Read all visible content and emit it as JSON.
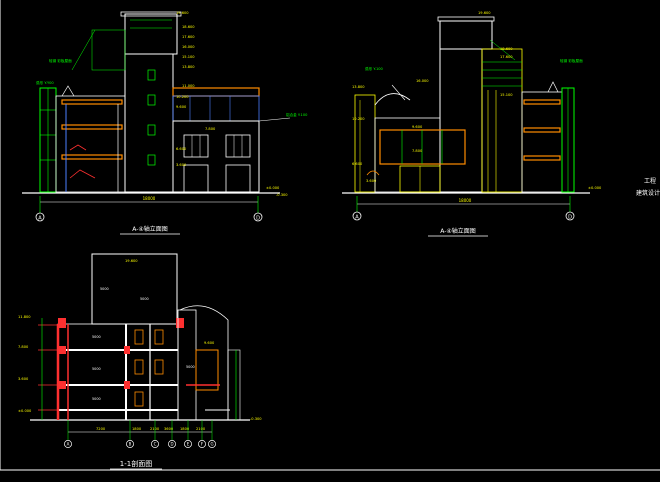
{
  "colors": {
    "background": "#000000",
    "frame": "#ffffff",
    "building": "#ffffff",
    "green": "#00ff00",
    "yellow": "#ffff00",
    "red": "#ff3030",
    "orange": "#ff8c00",
    "blue": "#4d7fff",
    "cyan": "#00ffff",
    "magenta": "#ff40ff",
    "pink": "#ff80c0",
    "dim": "#9a9a9a"
  },
  "drawing": {
    "front_elevation": {
      "title": "A-④轴立面图",
      "total_dim": "18000",
      "axis_left": "A",
      "axis_right": "D",
      "levels": [
        "19.600",
        "18.600",
        "17.600",
        "16.000",
        "15.100",
        "13.800",
        "11.000",
        "10.200",
        "9.600",
        "7.800",
        "6.600",
        "3.600",
        "±0.000",
        "-0.300"
      ],
      "notes": [
        "轻钢 彩板屋面",
        "铝合金 Y.100",
        "弧形 Y.Y00"
      ]
    },
    "side_elevation": {
      "title": "A-④轴立面图",
      "total_dim": "18000",
      "axis_left": "A",
      "axis_right": "D",
      "levels": [
        "19.600",
        "18.600",
        "17.600",
        "16.000",
        "15.100",
        "13.800",
        "10.200",
        "9.600",
        "7.800",
        "6.600",
        "3.600",
        "±0.000"
      ],
      "notes": [
        "弧形 Y.100",
        "轻钢 彩板屋面"
      ]
    },
    "section": {
      "title": "1-1剖面图",
      "level_labels": [
        "11.800",
        "7.800",
        "3.600",
        "±0.000",
        "-0.300",
        "19.600",
        "9.600"
      ],
      "room_labels": [
        "5000",
        "5000",
        "5000",
        "5000",
        "5000",
        "5000"
      ],
      "dims": [
        "7200",
        "1800",
        "2100",
        "3600",
        "1800",
        "2100"
      ],
      "axis_labels": [
        "A",
        "B",
        "C",
        "D",
        "E",
        "F",
        "G"
      ]
    },
    "side_note": [
      "工程",
      "建筑设计"
    ]
  }
}
